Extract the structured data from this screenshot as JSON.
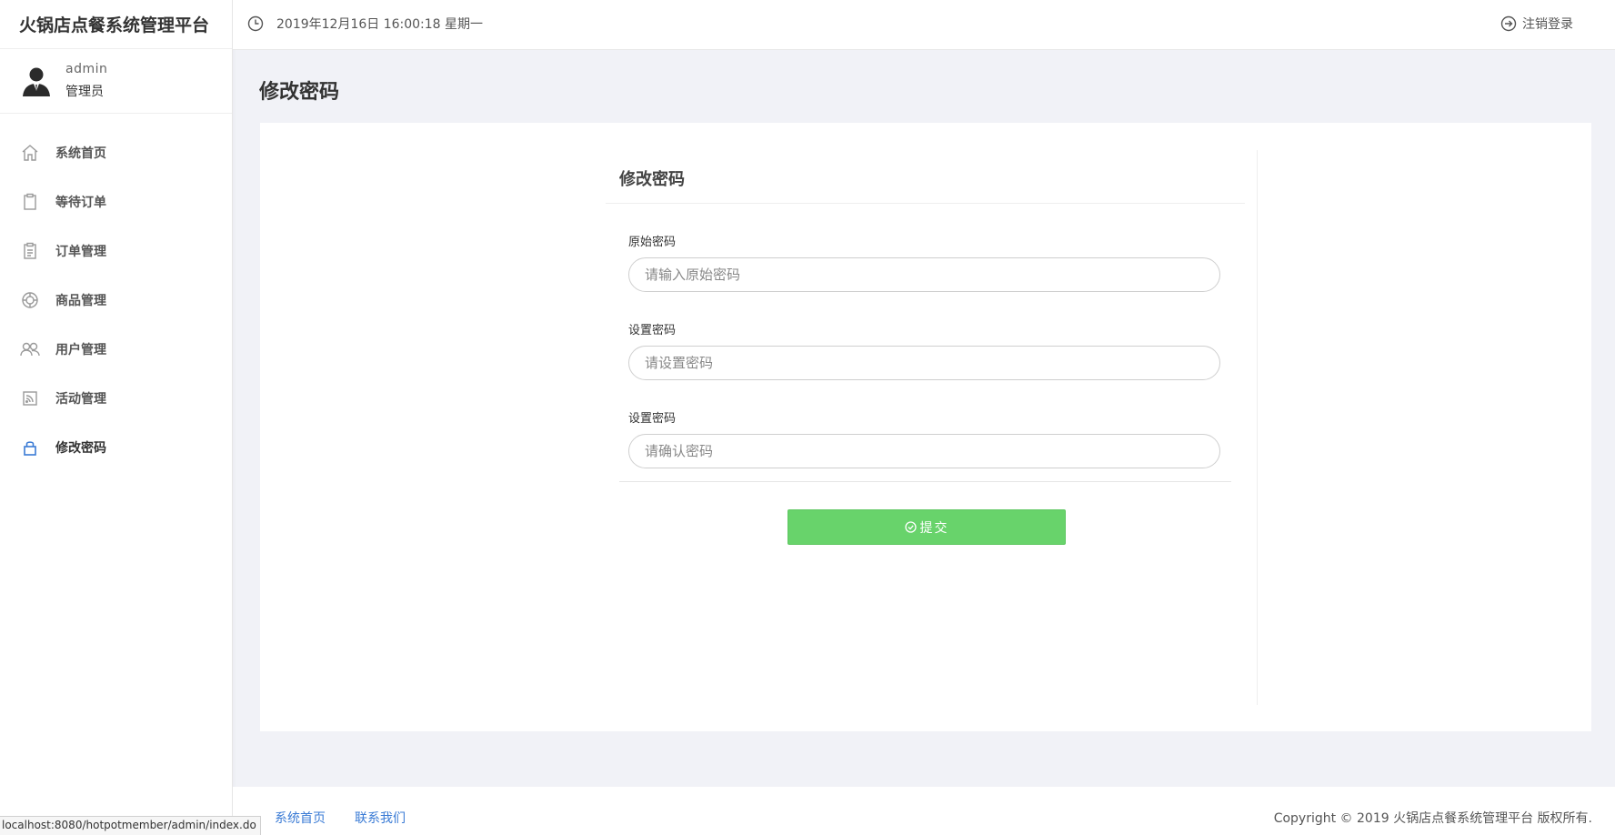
{
  "app": {
    "title": "火锅店点餐系统管理平台"
  },
  "user": {
    "name": "admin",
    "role": "管理员"
  },
  "sidebar": {
    "items": [
      {
        "label": "系统首页",
        "icon": "home-icon"
      },
      {
        "label": "等待订单",
        "icon": "clipboard-icon"
      },
      {
        "label": "订单管理",
        "icon": "clipboard-list-icon"
      },
      {
        "label": "商品管理",
        "icon": "product-icon"
      },
      {
        "label": "用户管理",
        "icon": "users-icon"
      },
      {
        "label": "活动管理",
        "icon": "rss-icon"
      },
      {
        "label": "修改密码",
        "icon": "lock-icon",
        "active": true
      }
    ]
  },
  "header": {
    "datetime": "2019年12月16日 16:00:18 星期一",
    "logout_label": "注销登录"
  },
  "main": {
    "page_title": "修改密码",
    "form": {
      "title": "修改密码",
      "fields": [
        {
          "label": "原始密码",
          "placeholder": "请输入原始密码",
          "value": ""
        },
        {
          "label": "设置密码",
          "placeholder": "请设置密码",
          "value": ""
        },
        {
          "label": "设置密码",
          "placeholder": "请确认密码",
          "value": ""
        }
      ],
      "submit_label": "提交"
    }
  },
  "footer": {
    "links": [
      "系统首页",
      "联系我们"
    ],
    "copyright": "Copyright © 2019 火锅店点餐系统管理平台 版权所有."
  },
  "status_bar": {
    "url": "localhost:8080/hotpotmember/admin/index.do"
  },
  "colors": {
    "accent_green": "#68d36b",
    "link_blue": "#3a7bd5",
    "active_icon_blue": "#3a7bd5",
    "background": "#f1f2f7"
  }
}
